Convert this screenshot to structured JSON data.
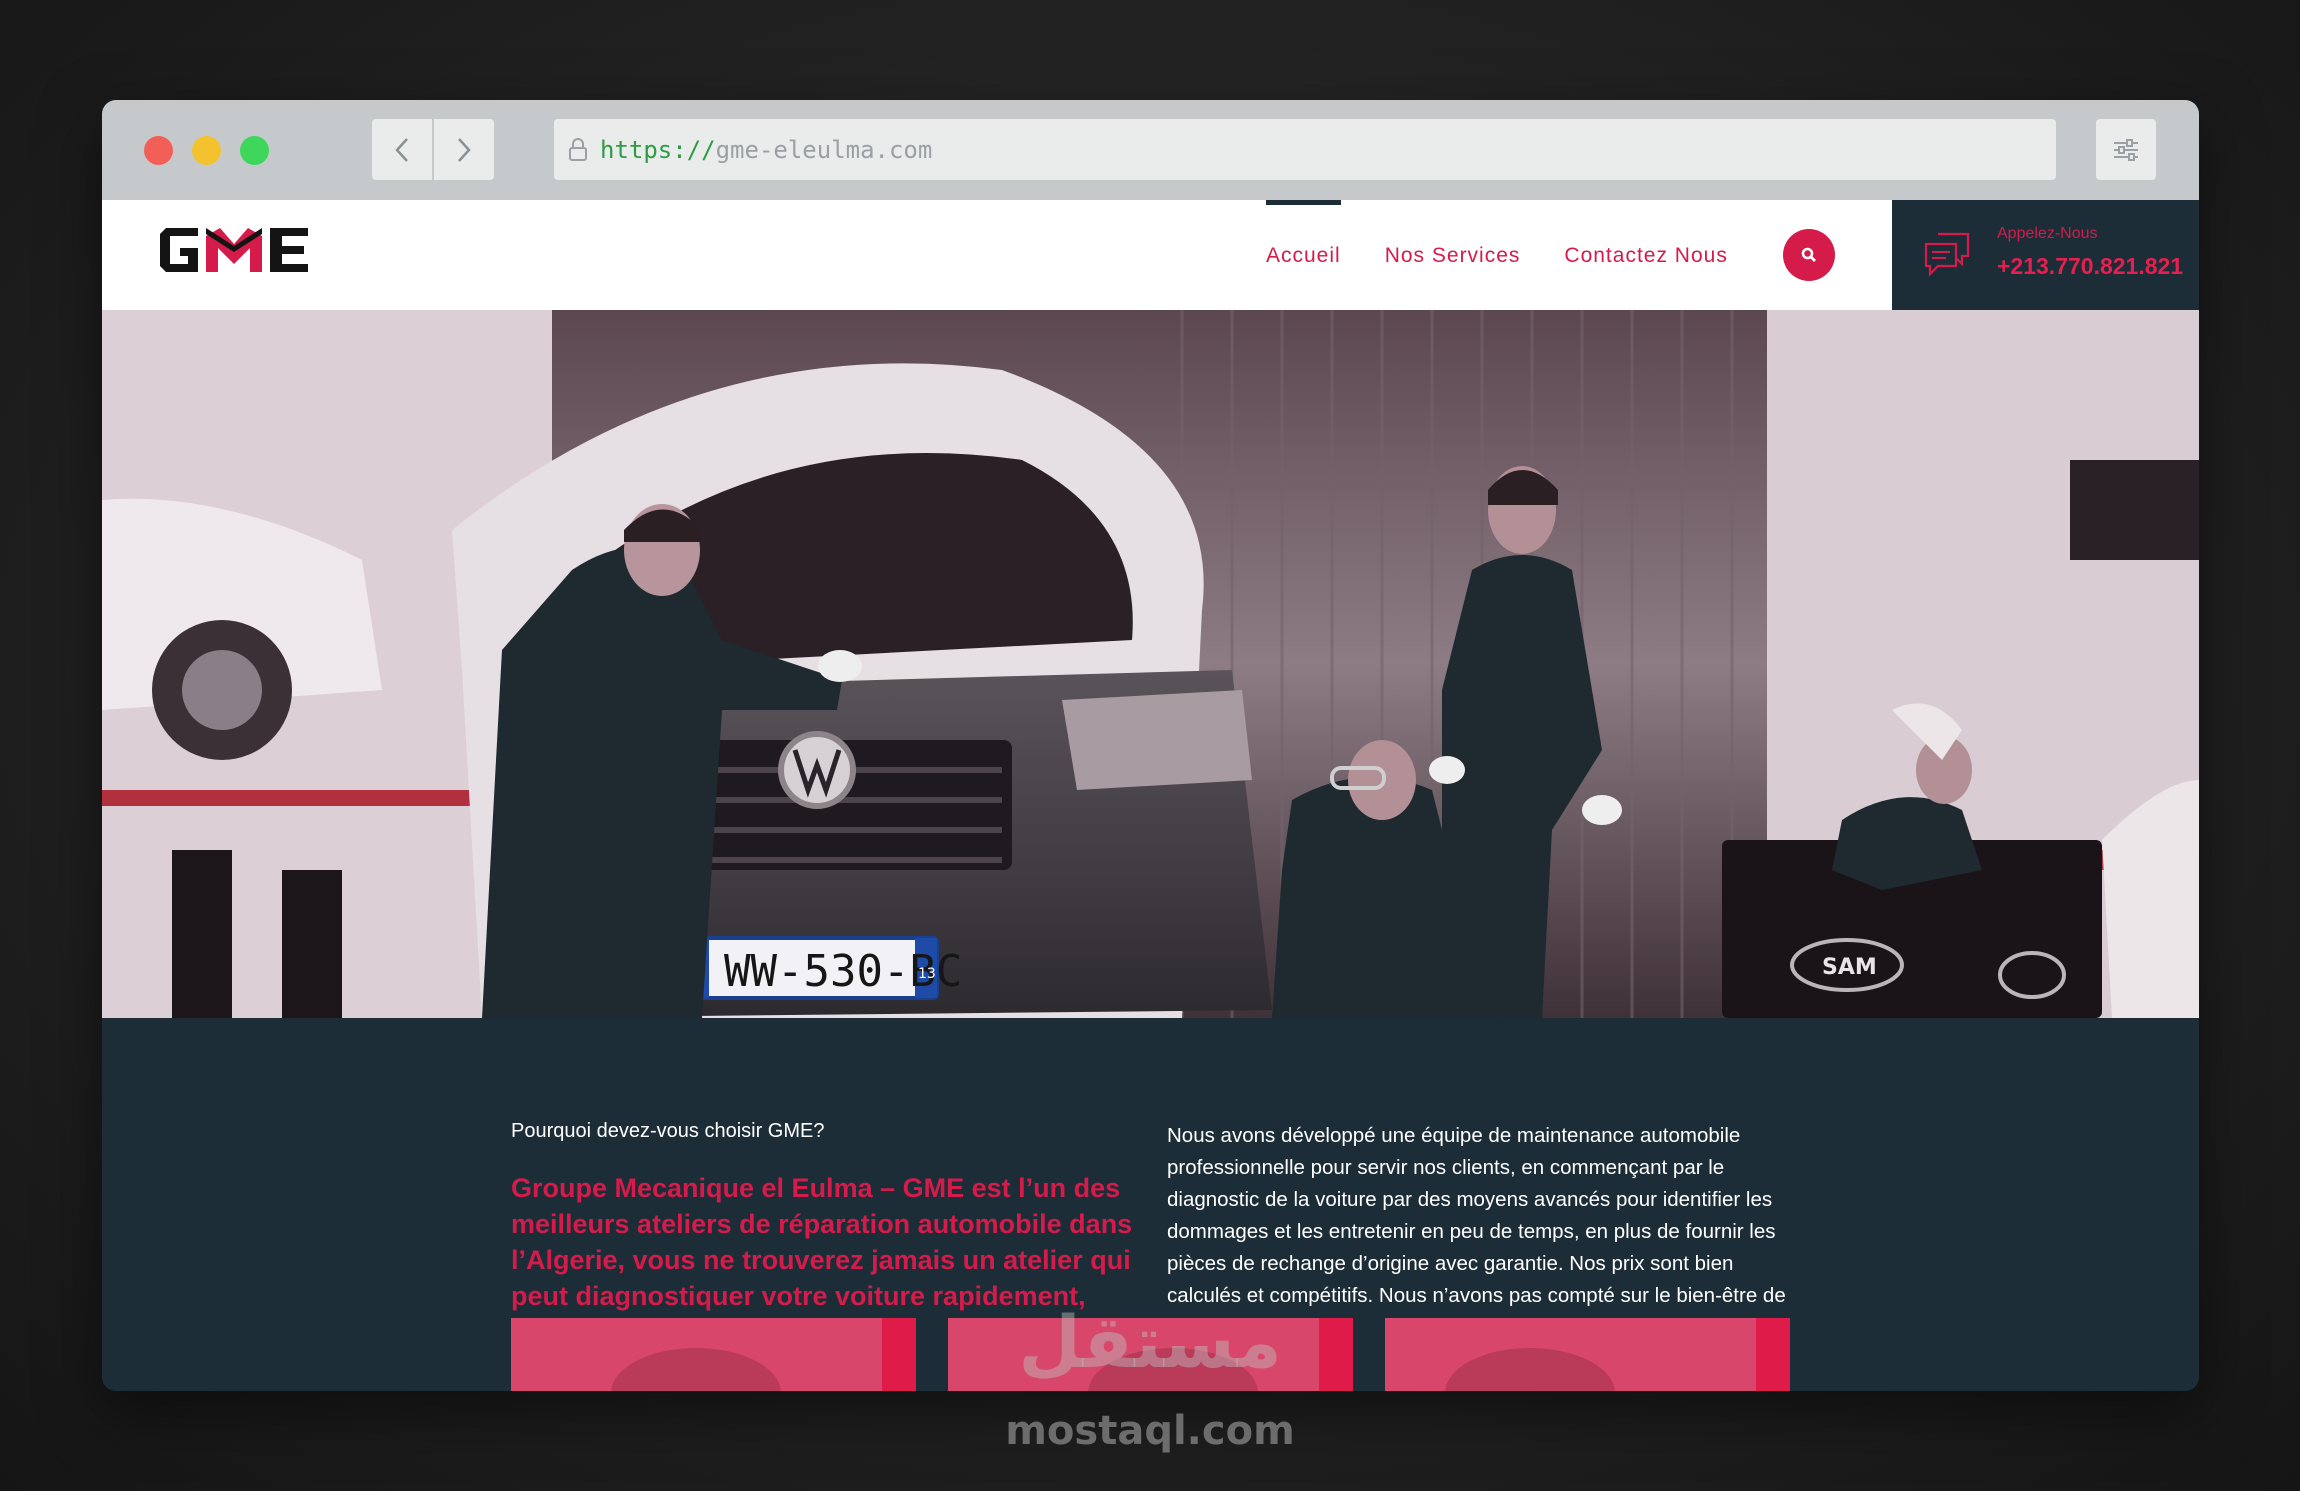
{
  "browser": {
    "url_scheme": "https://",
    "url_host": "gme-eleulma.com"
  },
  "header": {
    "logo_text": "GME",
    "menu": [
      {
        "label": "Accueil",
        "active": true
      },
      {
        "label": "Nos Services",
        "active": false
      },
      {
        "label": "Contactez Nous",
        "active": false
      }
    ],
    "call_label": "Appelez-Nous",
    "call_phone": "+213.770.821.821"
  },
  "hero": {
    "plate": "WW-530-BC",
    "plate_region": "13",
    "equipment_brand": "SAM"
  },
  "content": {
    "question": "Pourquoi devez-vous choisir GME?",
    "lead": "Groupe Mecanique el Eulma – GME est l’un des meilleurs ateliers de réparation automobile dans l’Algerie, vous ne trouverez jamais un atelier qui peut diagnostiquer votre voiture rapidement, proprement, précisément et d…",
    "paragraph": "Nous avons développé une équipe de maintenance automobile professionnelle pour servir nos clients, en commençant par le diagnostic de la voiture par des moyens avancés pour identifier les dommages et les entretenir en peu de temps, en plus de fournir les pièces de rechange d’origine avec garantie. Nos prix sont bien calculés et compétitifs. Nous n’avons pas compté sur le bien-être de notre discipline…"
  },
  "watermark": {
    "arabic": "مستقل",
    "latin": "mostaql.com"
  },
  "colors": {
    "brand_red": "#d41b4a",
    "navy": "#1d2d38"
  }
}
